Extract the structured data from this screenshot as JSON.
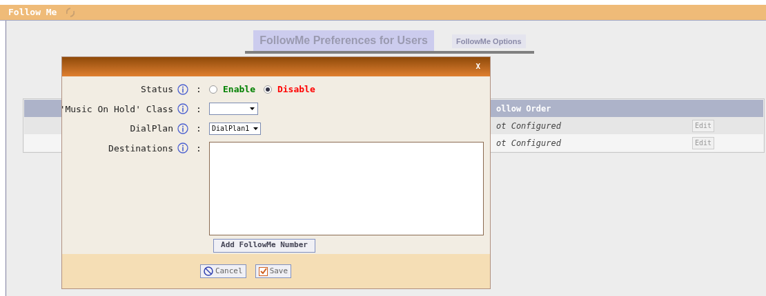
{
  "title_bar": {
    "title": "Follow Me"
  },
  "tabs": [
    {
      "label": "FollowMe Preferences for Users",
      "selected": true
    },
    {
      "label": "FollowMe Options",
      "selected": false
    }
  ],
  "table": {
    "columns": [
      "ollow Order"
    ],
    "rows": [
      {
        "order": "ot Configured",
        "action": "Edit"
      },
      {
        "order": "ot Configured",
        "action": "Edit"
      }
    ]
  },
  "dialog": {
    "close": "X",
    "status": {
      "label": "Status",
      "colon": ":",
      "options": [
        {
          "label": "Enable",
          "selected": false,
          "color": "#008000"
        },
        {
          "label": "Disable",
          "selected": true,
          "color": "#ff0000"
        }
      ]
    },
    "moh": {
      "label": "'Music On Hold' Class",
      "colon": ":"
    },
    "dialplan": {
      "label": "DialPlan",
      "colon": ":",
      "value": "DialPlan1"
    },
    "destinations": {
      "label": "Destinations",
      "colon": ":"
    },
    "add_button": "Add FollowMe Number",
    "buttons": [
      {
        "kind": "cancel",
        "label": "Cancel"
      },
      {
        "kind": "save",
        "label": "Save"
      }
    ]
  }
}
